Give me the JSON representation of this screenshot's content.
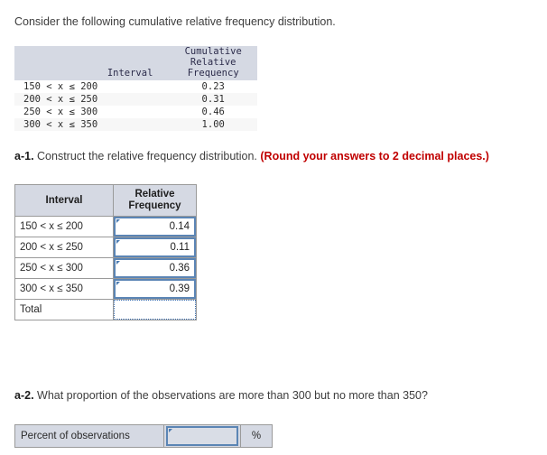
{
  "intro": {
    "text": "Consider the following cumulative relative frequency distribution."
  },
  "given_table": {
    "headers": {
      "interval": "Interval",
      "cumulative_relative_frequency": "Cumulative\nRelative\nFrequency"
    },
    "rows": [
      {
        "interval": "150 < x ≤ 200",
        "value": "0.23"
      },
      {
        "interval": "200 < x ≤ 250",
        "value": "0.31"
      },
      {
        "interval": "250 < x ≤ 300",
        "value": "0.46"
      },
      {
        "interval": "300 < x ≤ 350",
        "value": "1.00"
      }
    ]
  },
  "question_a1": {
    "number": "a-1.",
    "text": "Construct the relative frequency distribution.",
    "hint": "(Round your answers to 2 decimal places.)"
  },
  "answer_table": {
    "headers": {
      "interval": "Interval",
      "relative_frequency": "Relative\nFrequency"
    },
    "rows": [
      {
        "interval": "150 < x ≤ 200",
        "value": "0.14"
      },
      {
        "interval": "200 < x ≤ 250",
        "value": "0.11"
      },
      {
        "interval": "250 < x ≤ 300",
        "value": "0.36"
      },
      {
        "interval": "300 < x ≤ 350",
        "value": "0.39"
      }
    ],
    "total_label": "Total",
    "total_value": ""
  },
  "question_a2": {
    "number": "a-2.",
    "text": "What proportion of the observations are more than 300 but no more than 350?"
  },
  "percent_row": {
    "label": "Percent of observations",
    "value": "",
    "unit": "%"
  },
  "colors": {
    "header_bg": "#d5d9e3",
    "input_border": "#5b85b5",
    "hint_red": "#c00000",
    "table_border": "#9a9a9a",
    "alt_row_bg": "#f7f7f7"
  }
}
